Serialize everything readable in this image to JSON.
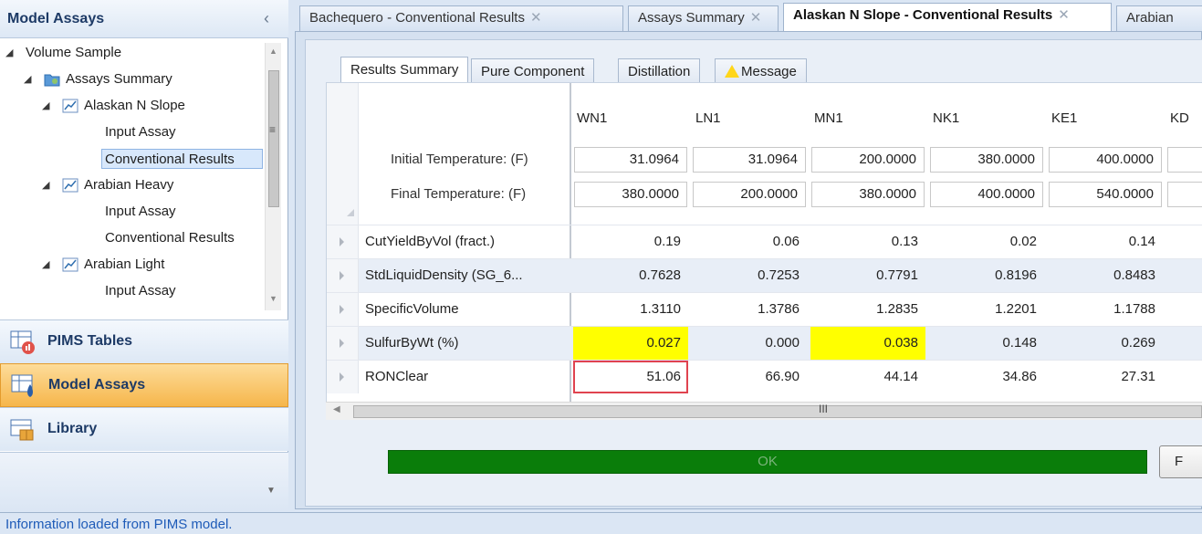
{
  "left_panel": {
    "title": "Model Assays",
    "collapse_glyph": "‹",
    "tree": [
      {
        "label": "Volume Sample",
        "level": 0,
        "expanded": true,
        "icon": "none"
      },
      {
        "label": "Assays Summary",
        "level": 1,
        "expanded": true,
        "icon": "folder-icon"
      },
      {
        "label": "Alaskan N Slope",
        "level": 2,
        "expanded": true,
        "icon": "chart-line-icon"
      },
      {
        "label": "Input Assay",
        "level": 3,
        "icon": "none"
      },
      {
        "label": "Conventional Results",
        "level": 3,
        "icon": "none",
        "selected": true
      },
      {
        "label": "Arabian Heavy",
        "level": 2,
        "expanded": true,
        "icon": "chart-line-icon"
      },
      {
        "label": "Input Assay",
        "level": 3,
        "icon": "none"
      },
      {
        "label": "Conventional Results",
        "level": 3,
        "icon": "none"
      },
      {
        "label": "Arabian Light",
        "level": 2,
        "expanded": true,
        "icon": "chart-line-icon"
      },
      {
        "label": "Input Assay",
        "level": 3,
        "icon": "none"
      }
    ],
    "nav": [
      {
        "label": "PIMS Tables",
        "icon": "pims-tables-icon",
        "active": false
      },
      {
        "label": "Model Assays",
        "icon": "model-assays-icon",
        "active": true
      },
      {
        "label": "Library",
        "icon": "library-icon",
        "active": false
      }
    ]
  },
  "doc_tabs": [
    {
      "label": "Bachequero - Conventional Results",
      "active": false
    },
    {
      "label": "Assays Summary",
      "active": false
    },
    {
      "label": "Alaskan N Slope - Conventional Results",
      "active": true
    },
    {
      "label": "Arabian",
      "active": false
    }
  ],
  "sub_tabs": [
    {
      "label": "Results Summary",
      "active": true
    },
    {
      "label": "Pure Component",
      "active": false
    },
    {
      "label": "Distillation",
      "active": false
    },
    {
      "label": "Message",
      "active": false,
      "warning": true
    }
  ],
  "grid": {
    "columns": [
      "WN1",
      "LN1",
      "MN1",
      "NK1",
      "KE1",
      "KD"
    ],
    "header_rows": [
      {
        "label": "Initial Temperature: (F)",
        "values": [
          "31.0964",
          "31.0964",
          "200.0000",
          "380.0000",
          "400.0000",
          ""
        ]
      },
      {
        "label": "Final Temperature: (F)",
        "values": [
          "380.0000",
          "200.0000",
          "380.0000",
          "400.0000",
          "540.0000",
          ""
        ]
      }
    ],
    "rows": [
      {
        "label": "CutYieldByVol (fract.)",
        "values": [
          "0.19",
          "0.06",
          "0.13",
          "0.02",
          "0.14"
        ],
        "highlight": []
      },
      {
        "label": "StdLiquidDensity (SG_6...",
        "values": [
          "0.7628",
          "0.7253",
          "0.7791",
          "0.8196",
          "0.8483"
        ],
        "highlight": []
      },
      {
        "label": "SpecificVolume",
        "values": [
          "1.3110",
          "1.3786",
          "1.2835",
          "1.2201",
          "1.1788"
        ],
        "highlight": []
      },
      {
        "label": "SulfurByWt (%)",
        "values": [
          "0.027",
          "0.000",
          "0.038",
          "0.148",
          "0.269"
        ],
        "highlight": [
          0,
          2
        ]
      },
      {
        "label": "RONClear",
        "values": [
          "51.06",
          "66.90",
          "44.14",
          "34.86",
          "27.31"
        ],
        "highlight": [],
        "boxed": [
          0
        ]
      }
    ],
    "scroll_grip": "III"
  },
  "ok_label": "OK",
  "p_button_label": "F",
  "status": "Information loaded from PIMS model.",
  "colors": {
    "highlight": "#ffff00",
    "ok_bar": "#0a7d0a",
    "callout_box": "#e0434f",
    "active_nav": "#f6b64b",
    "status_text": "#1e5bb8"
  }
}
